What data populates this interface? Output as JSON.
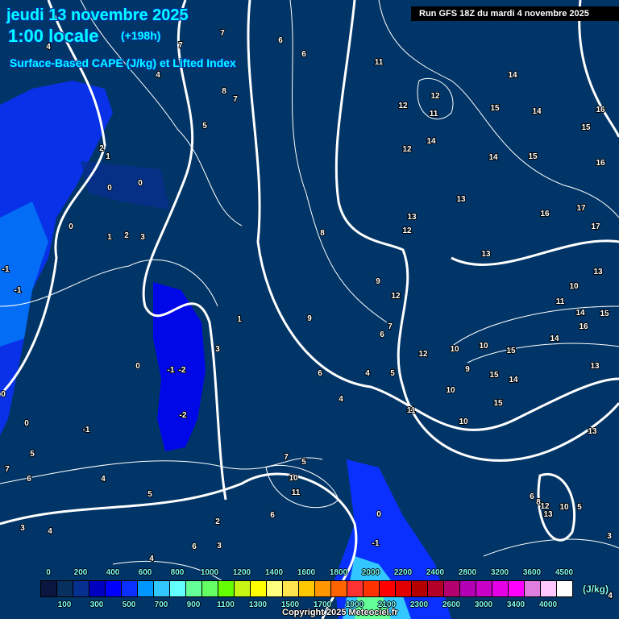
{
  "header": {
    "date": "jeudi 13 novembre 2025",
    "time": "1:00 locale",
    "lead": "(+198h)",
    "parameter": "Surface-Based CAPE (J/kg) et Lifted Index",
    "run": "Run GFS 18Z du mardi 4 novembre 2025"
  },
  "colorbar": {
    "labels": [
      "0",
      "100",
      "200",
      "300",
      "400",
      "500",
      "600",
      "700",
      "800",
      "900",
      "1000",
      "1100",
      "1200",
      "1300",
      "1400",
      "1500",
      "1600",
      "1700",
      "1800",
      "1900",
      "2000",
      "2100",
      "2200",
      "2300",
      "2400",
      "2600",
      "2800",
      "3000",
      "3200",
      "3400",
      "3600",
      "4000",
      "4500"
    ],
    "colors": [
      "#0a1640",
      "#07305e",
      "#06308f",
      "#0000c0",
      "#0000ff",
      "#0a30ff",
      "#0096ff",
      "#32c8ff",
      "#64ffff",
      "#64ff96",
      "#64ff64",
      "#64ff00",
      "#c8f514",
      "#ffff00",
      "#ffff80",
      "#ffe650",
      "#ffc800",
      "#ff9600",
      "#ff6400",
      "#ff3232",
      "#ff3200",
      "#ff0000",
      "#e00000",
      "#b40000",
      "#b40028",
      "#b4006e",
      "#b400b4",
      "#c800c8",
      "#e600e6",
      "#ff00ff",
      "#e07ee0",
      "#ffc8ff",
      "#ffffff"
    ],
    "unit": "(J/kg)"
  },
  "copyright": "Copyright 2025 Meteociel.fr",
  "lifted_index_labels": [
    "11",
    "12",
    "12",
    "11",
    "15",
    "14",
    "14",
    "16",
    "15",
    "14",
    "12",
    "14",
    "15",
    "16",
    "13",
    "16",
    "17",
    "17",
    "13",
    "12",
    "13",
    "13",
    "10",
    "11",
    "14",
    "16",
    "15",
    "9",
    "12",
    "8",
    "9",
    "1",
    "3",
    "6",
    "7",
    "12",
    "10",
    "10",
    "15",
    "14",
    "9",
    "15",
    "14",
    "13",
    "10",
    "15",
    "10",
    "13",
    "11",
    "5",
    "4",
    "6",
    "4",
    "7",
    "5",
    "10",
    "11",
    "6",
    "0",
    "-1",
    "5",
    "4",
    "5",
    "7",
    "6",
    "3",
    "4",
    "2",
    "3",
    "6",
    "4",
    "0",
    "0",
    "-1",
    "-2",
    "0",
    "-1",
    "-2",
    "0",
    "1",
    "2",
    "3",
    "0",
    "0",
    "2",
    "1",
    "-1",
    "-1",
    "8",
    "7",
    "5",
    "4",
    "7",
    "7",
    "6",
    "6",
    "4",
    "6",
    "8",
    "12",
    "13",
    "10",
    "5",
    "3",
    "4"
  ]
}
